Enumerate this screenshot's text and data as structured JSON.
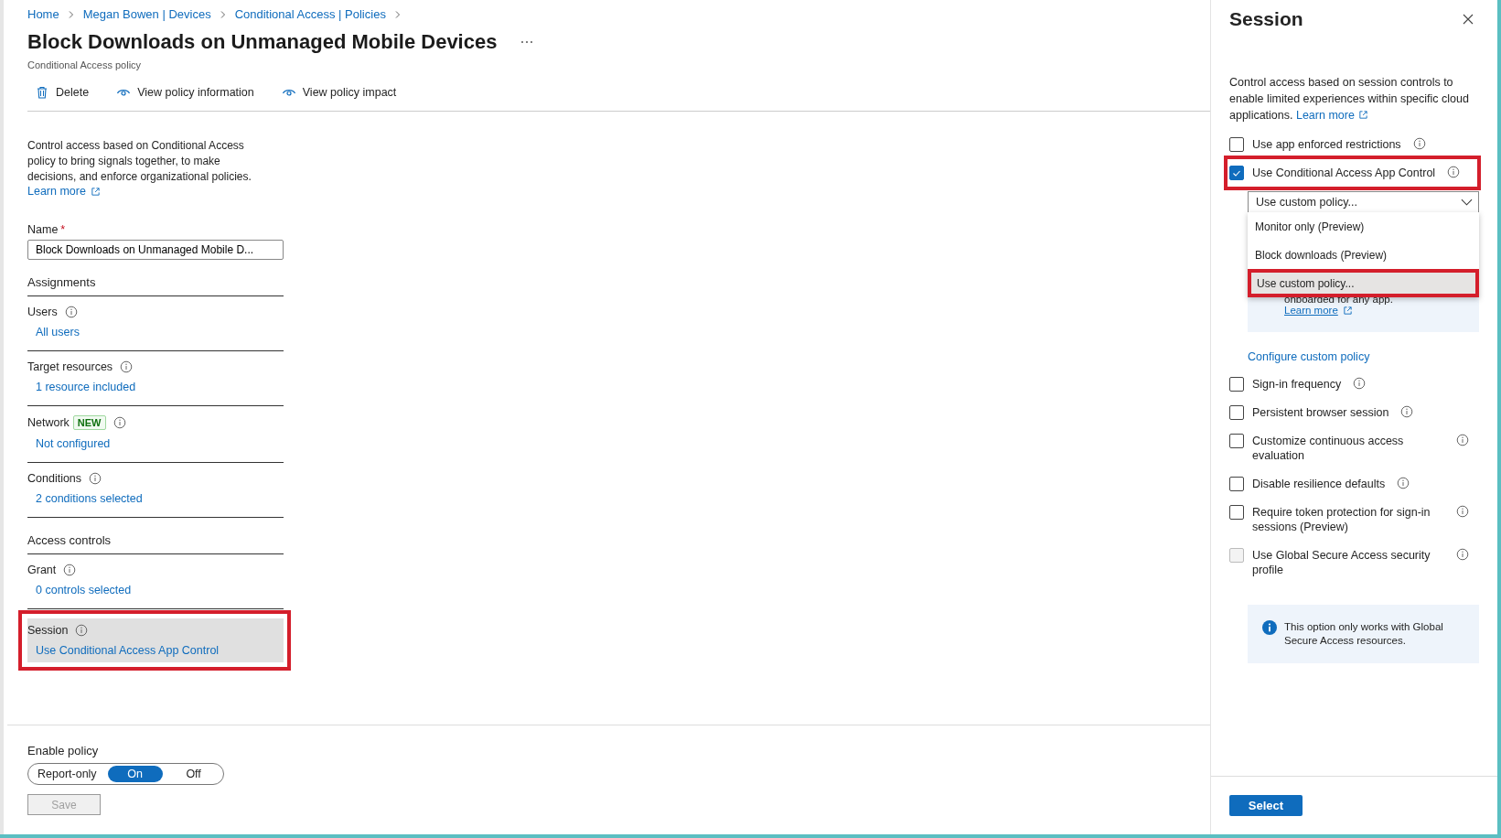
{
  "breadcrumb": [
    "Home",
    "Megan Bowen | Devices",
    "Conditional Access | Policies"
  ],
  "page": {
    "title": "Block Downloads on Unmanaged Mobile Devices",
    "subtitle": "Conditional Access policy"
  },
  "toolbar": [
    {
      "kind": "delete",
      "label": "Delete"
    },
    {
      "kind": "view",
      "label": "View policy information"
    },
    {
      "kind": "view",
      "label": "View policy impact"
    }
  ],
  "description": {
    "text": "Control access based on Conditional Access policy to bring signals together, to make decisions, and enforce organizational policies.",
    "link": "Learn more"
  },
  "name_field": {
    "label": "Name",
    "required_mark": "*",
    "value": "Block Downloads on Unmanaged Mobile D..."
  },
  "sections": [
    {
      "heading": "Assignments",
      "items": [
        {
          "label": "Users",
          "value": "All users",
          "highlighted": false
        },
        {
          "label": "Target resources",
          "value": "1 resource included",
          "highlighted": false
        },
        {
          "label": "Network",
          "badge": "NEW",
          "value": "Not configured",
          "highlighted": false
        },
        {
          "label": "Conditions",
          "value": "2 conditions selected",
          "highlighted": false
        }
      ]
    },
    {
      "heading": "Access controls",
      "items": [
        {
          "label": "Grant",
          "value": "0 controls selected",
          "highlighted": false
        },
        {
          "label": "Session",
          "value": "Use Conditional Access App Control",
          "highlighted": true
        }
      ]
    }
  ],
  "enable_policy": {
    "label": "Enable policy",
    "options": [
      {
        "label": "Report-only",
        "selected": false
      },
      {
        "label": "On",
        "selected": true
      },
      {
        "label": "Off",
        "selected": false
      }
    ]
  },
  "save_button": {
    "label": "Save",
    "disabled": true
  },
  "panel": {
    "title": "Session",
    "description": "Control access based on session controls to enable limited experiences within specific cloud applications.",
    "link": "Learn more",
    "options_top": [
      {
        "label": "Use app enforced restrictions",
        "checked": false,
        "disabled": false,
        "highlighted": false
      },
      {
        "label": "Use Conditional Access App Control",
        "checked": true,
        "disabled": false,
        "highlighted": true
      }
    ],
    "dropdown": {
      "value": "Use custom policy...",
      "expanded": true,
      "menu": [
        {
          "label": "Monitor only (Preview)",
          "selected": false,
          "highlighted": false
        },
        {
          "label": "Block downloads (Preview)",
          "selected": false,
          "highlighted": false
        },
        {
          "label": "Use custom policy...",
          "selected": true,
          "highlighted": true
        }
      ]
    },
    "note": {
      "text": "onboarded for any app.",
      "link": "Learn more"
    },
    "configure_link": "Configure custom policy",
    "options_bottom": [
      {
        "label": "Sign-in frequency",
        "checked": false,
        "disabled": false,
        "highlighted": false
      },
      {
        "label": "Persistent browser session",
        "checked": false,
        "disabled": false,
        "highlighted": false
      },
      {
        "label": "Customize continuous access evaluation",
        "checked": false,
        "disabled": false,
        "highlighted": false
      },
      {
        "label": "Disable resilience defaults",
        "checked": false,
        "disabled": false,
        "highlighted": false
      },
      {
        "label": "Require token protection for sign-in sessions (Preview)",
        "checked": false,
        "disabled": false,
        "highlighted": false
      },
      {
        "label": "Use Global Secure Access security profile",
        "checked": false,
        "disabled": true,
        "highlighted": false
      }
    ],
    "notice": "This option only works with Global Secure Access resources.",
    "select_button": "Select"
  }
}
